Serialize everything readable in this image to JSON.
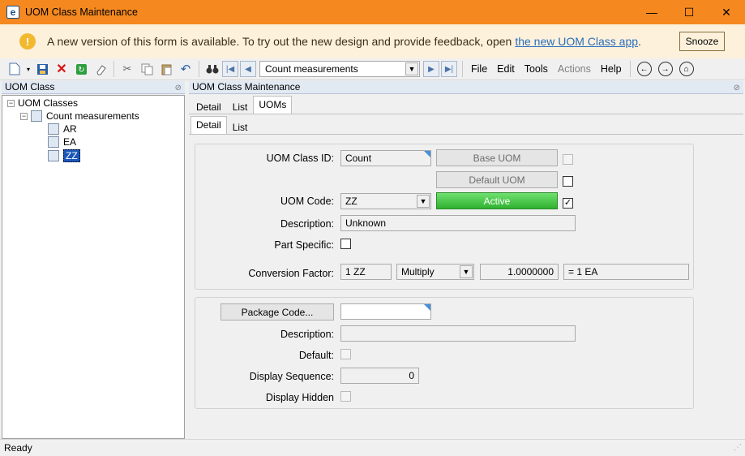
{
  "window": {
    "title": "UOM Class Maintenance",
    "logo_letter": "e",
    "minimize": "—",
    "maximize": "☐",
    "close": "✕"
  },
  "notification": {
    "icon": "!",
    "text": "A new version of this form is available. To try out the new design and provide feedback, open",
    "link": "the new UOM Class app",
    "trailing": ".",
    "snooze": "Snooze"
  },
  "toolbar": {
    "record_value": "Count measurements",
    "menus": [
      "File",
      "Edit",
      "Tools",
      "Actions",
      "Help"
    ]
  },
  "tree": {
    "header": "UOM Class",
    "root": "UOM Classes",
    "child": "Count measurements",
    "leaves": [
      "AR",
      "EA",
      "ZZ"
    ]
  },
  "main": {
    "header": "UOM Class Maintenance",
    "top_tabs": [
      "Detail",
      "List",
      "UOMs"
    ],
    "sub_tabs": [
      "Detail",
      "List"
    ]
  },
  "uom_form": {
    "class_id_label": "UOM Class ID:",
    "class_id_value": "Count",
    "base_uom_btn": "Base UOM",
    "default_uom_btn": "Default UOM",
    "uom_code_label": "UOM Code:",
    "uom_code_value": "ZZ",
    "active_btn": "Active",
    "description_label": "Description:",
    "description_value": "Unknown",
    "part_specific_label": "Part Specific:",
    "conversion_label": "Conversion Factor:",
    "conversion_uom": "1 ZZ",
    "conversion_op": "Multiply",
    "conversion_factor": "1.0000000",
    "conversion_result": "= 1 EA"
  },
  "package_form": {
    "package_code_btn": "Package Code...",
    "description_label": "Description:",
    "default_label": "Default:",
    "display_sequence_label": "Display Sequence:",
    "display_sequence_value": "0",
    "display_hidden_label": "Display Hidden"
  },
  "status": {
    "text": "Ready"
  },
  "colors": {
    "title_bar": "#f5891f",
    "notification_bg": "#fdf1dc",
    "active_green": "#2fb12f",
    "selection_blue": "#1a57b8"
  }
}
